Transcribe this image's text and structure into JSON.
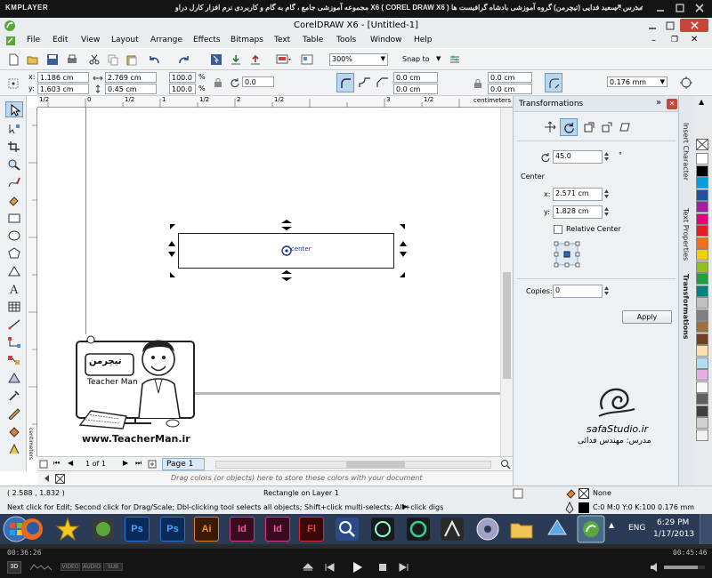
{
  "kmplayer": {
    "logo": "KMPLAYER",
    "title": "مجموعه آموزشی جامع ، گام به گام و کاربردی نرم افزار کارل دراو  X6  ( COREL DRAW X6 )  مدرس : سعید فدایی (تیچرمن) گروه آموزشی بادشاه گرافیست ها",
    "time_elapsed": "00:36:26",
    "time_total": "00:45:46",
    "badge_3d": "3D",
    "mini_labels": [
      "VIDEO",
      "AUDIO",
      "SUB"
    ]
  },
  "app": {
    "title": "CorelDRAW X6 - [Untitled-1]"
  },
  "menu": [
    "File",
    "Edit",
    "View",
    "Layout",
    "Arrange",
    "Effects",
    "Bitmaps",
    "Text",
    "Table",
    "Tools",
    "Window",
    "Help"
  ],
  "toolbar1": {
    "zoom": "300%",
    "snap_label": "Snap to"
  },
  "property_bar": {
    "x_label": "x:",
    "x": "1.186 cm",
    "y_label": "y:",
    "y": "1.603 cm",
    "w": "2.769 cm",
    "h": "0.45 cm",
    "scale_w": "100.0",
    "scale_h": "100.0",
    "scale_unit": "%",
    "rotation": "0.0",
    "corner_1": "0.0 cm",
    "corner_2": "0.0 cm",
    "corner_3": "0.0 cm",
    "corner_4": "0.0 cm",
    "outline_width": "0.176 mm"
  },
  "ruler": {
    "top_labels": [
      "1/2",
      "0",
      "1/2",
      "1",
      "1/2",
      "2",
      "1/2",
      "3",
      "1/2"
    ],
    "unit": "centimeters"
  },
  "canvas": {
    "center_label": "center"
  },
  "watermark": {
    "brand": "تیچرمن",
    "name": "Teacher Man",
    "url": "www.TeacherMan.ir"
  },
  "docker": {
    "title": "Transformations",
    "angle": "45.0",
    "angle_unit": "°",
    "center_heading": "Center",
    "cx_label": "x:",
    "cx": "2.571 cm",
    "cy_label": "y:",
    "cy": "1.828 cm",
    "relative_center": "Relative Center",
    "copies_label": "Copies:",
    "copies": "0",
    "apply": "Apply",
    "studio": "safaStudio.ir",
    "teacher": "مدرس: مهندس فدائی"
  },
  "docker_tabs": [
    "Insert Character",
    "Text Properties",
    "Transformations"
  ],
  "page_nav": {
    "counter": "1 of 1",
    "page_tab": "Page 1"
  },
  "palette_hint": "Drag colors (or objects) here to store these colors with your document",
  "status": {
    "coords": "( 2.588 , 1.832 )",
    "object": "Rectangle on Layer 1",
    "fill": "None",
    "outline": "C:0 M:0 Y:0 K:100  0.176 mm",
    "hint": "Next click for Edit; Second click for Drag/Scale; Dbl-clicking tool selects all objects; Shift+click multi-selects; Alt+click digs"
  },
  "taskbar": {
    "lang": "ENG",
    "time": "6:29 PM",
    "date": "1/17/2013"
  },
  "colors": {
    "palette": [
      "#ffffff",
      "#000000",
      "#00a0e0",
      "#2050a0",
      "#a020a0",
      "#e0007a",
      "#e02020",
      "#f07020",
      "#f0d000",
      "#90c020",
      "#20a040",
      "#008080",
      "#c0c0c0",
      "#808080",
      "#a07040",
      "#704020",
      "#ffe0b0",
      "#b0e0f0",
      "#e0b0e0",
      "#f8f8f8",
      "#606060",
      "#404040",
      "#d0d0d0",
      "#f0f0f0"
    ]
  }
}
